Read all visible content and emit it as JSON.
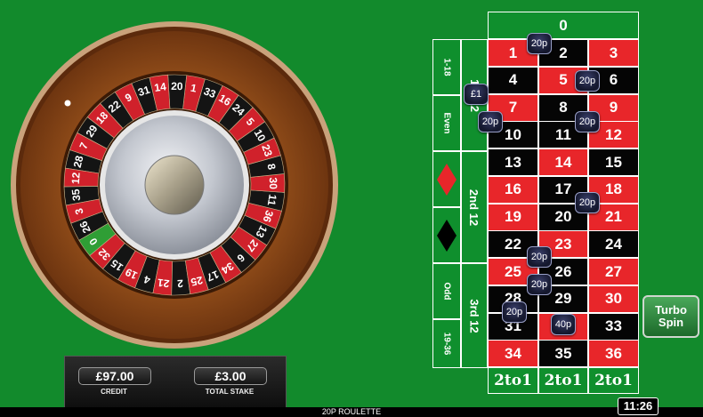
{
  "wheel": {
    "sequence": [
      0,
      32,
      15,
      19,
      4,
      21,
      2,
      25,
      17,
      34,
      6,
      27,
      13,
      36,
      11,
      30,
      8,
      23,
      10,
      5,
      24,
      16,
      33,
      1,
      20,
      14,
      31,
      9,
      22,
      18,
      29,
      7,
      28,
      12,
      35,
      3,
      26
    ],
    "colors": {
      "red": "#d0212b",
      "black": "#141414",
      "green": "#2f9e35"
    }
  },
  "stats": {
    "credit_value": "£97.00",
    "credit_label": "CREDIT",
    "stake_value": "£3.00",
    "stake_label": "TOTAL STAKE"
  },
  "board": {
    "zero": "0",
    "rows": [
      [
        {
          "n": "1",
          "c": "red"
        },
        {
          "n": "2",
          "c": "black"
        },
        {
          "n": "3",
          "c": "red"
        }
      ],
      [
        {
          "n": "4",
          "c": "black"
        },
        {
          "n": "5",
          "c": "red"
        },
        {
          "n": "6",
          "c": "black"
        }
      ],
      [
        {
          "n": "7",
          "c": "red"
        },
        {
          "n": "8",
          "c": "black"
        },
        {
          "n": "9",
          "c": "red"
        }
      ],
      [
        {
          "n": "10",
          "c": "black"
        },
        {
          "n": "11",
          "c": "black"
        },
        {
          "n": "12",
          "c": "red"
        }
      ],
      [
        {
          "n": "13",
          "c": "black"
        },
        {
          "n": "14",
          "c": "red"
        },
        {
          "n": "15",
          "c": "black"
        }
      ],
      [
        {
          "n": "16",
          "c": "red"
        },
        {
          "n": "17",
          "c": "black"
        },
        {
          "n": "18",
          "c": "red"
        }
      ],
      [
        {
          "n": "19",
          "c": "red"
        },
        {
          "n": "20",
          "c": "black"
        },
        {
          "n": "21",
          "c": "red"
        }
      ],
      [
        {
          "n": "22",
          "c": "black"
        },
        {
          "n": "23",
          "c": "red"
        },
        {
          "n": "24",
          "c": "black"
        }
      ],
      [
        {
          "n": "25",
          "c": "red"
        },
        {
          "n": "26",
          "c": "black"
        },
        {
          "n": "27",
          "c": "red"
        }
      ],
      [
        {
          "n": "28",
          "c": "black"
        },
        {
          "n": "29",
          "c": "black"
        },
        {
          "n": "30",
          "c": "red"
        }
      ],
      [
        {
          "n": "31",
          "c": "black"
        },
        {
          "n": "32",
          "c": "red"
        },
        {
          "n": "33",
          "c": "black"
        }
      ],
      [
        {
          "n": "34",
          "c": "red"
        },
        {
          "n": "35",
          "c": "black"
        },
        {
          "n": "36",
          "c": "red"
        }
      ]
    ],
    "outside": {
      "low": "1-18",
      "even": "Even",
      "odd": "Odd",
      "high": "19-36",
      "red_color": "#e8262a",
      "black_color": "#000000"
    },
    "dozens": {
      "first": "1st 12",
      "second": "2nd 12",
      "third": "3rd 12"
    },
    "columns": [
      "2to1",
      "2to1",
      "2to1"
    ],
    "chips": [
      {
        "label": "20p"
      },
      {
        "label": "20p"
      },
      {
        "label": "£1"
      },
      {
        "label": "20p"
      },
      {
        "label": "20p"
      },
      {
        "label": "20p"
      },
      {
        "label": "20p"
      },
      {
        "label": "20p"
      },
      {
        "label": "20p"
      },
      {
        "label": "40p"
      }
    ]
  },
  "turbo_spin": "Turbo Spin",
  "footer": {
    "game_title": "20P ROULETTE",
    "clock": "11:26"
  }
}
